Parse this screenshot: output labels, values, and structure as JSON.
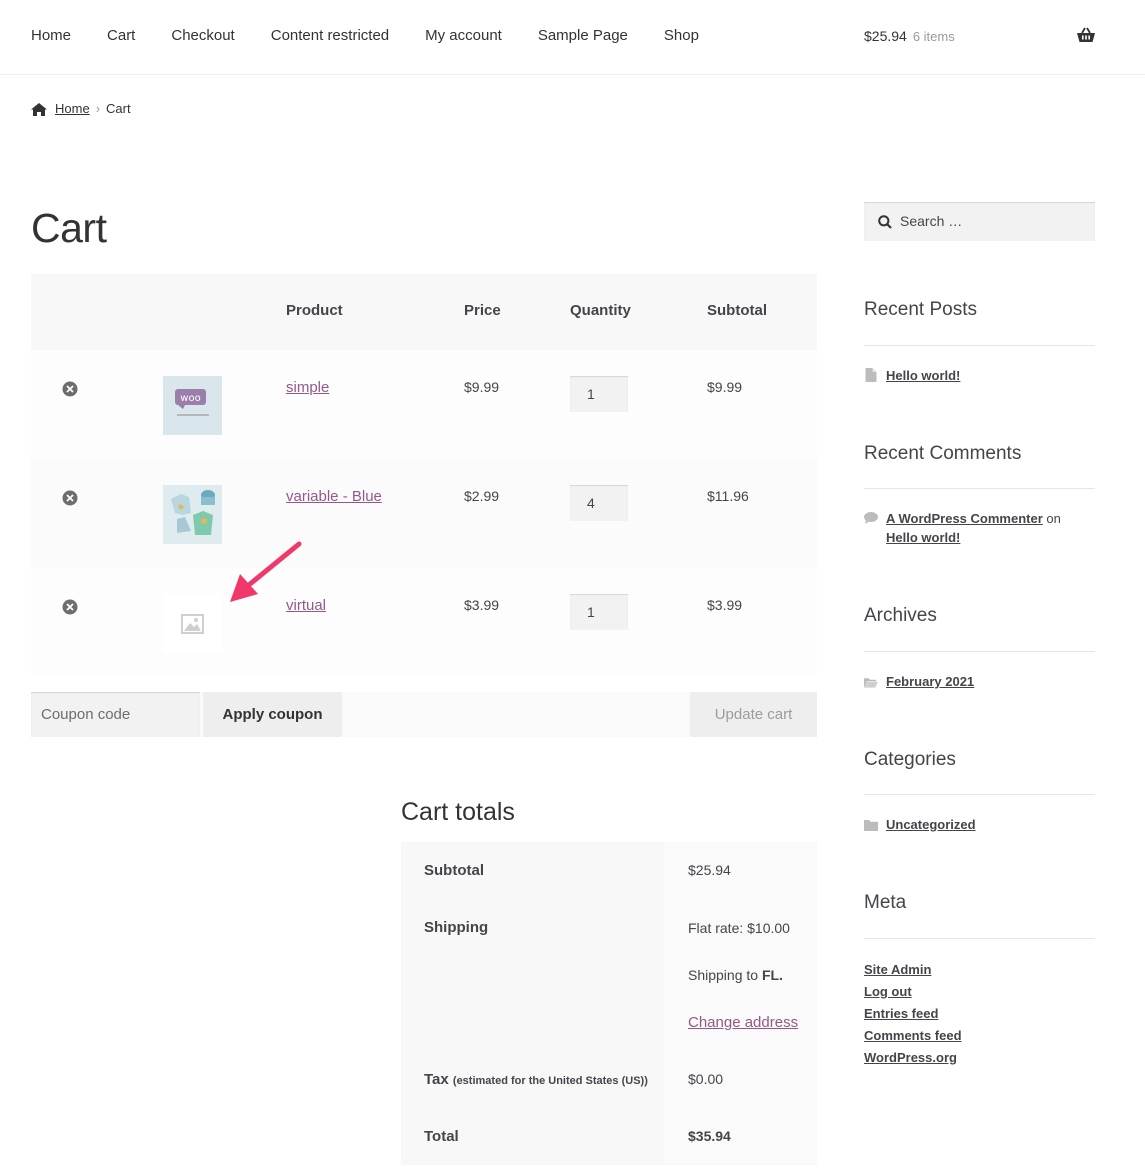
{
  "nav": {
    "items": [
      "Home",
      "Cart",
      "Checkout",
      "Content restricted",
      "My account",
      "Sample Page",
      "Shop"
    ]
  },
  "mini_cart": {
    "amount": "$25.94",
    "count": "6 items"
  },
  "breadcrumb": {
    "home": "Home",
    "current": "Cart"
  },
  "page_title": "Cart",
  "cart_table": {
    "headers": {
      "product": "Product",
      "price": "Price",
      "quantity": "Quantity",
      "subtotal": "Subtotal"
    },
    "rows": [
      {
        "name": "simple",
        "price": "$9.99",
        "qty": "1",
        "subtotal": "$9.99"
      },
      {
        "name": "variable - Blue",
        "price": "$2.99",
        "qty": "4",
        "subtotal": "$11.96"
      },
      {
        "name": "virtual",
        "price": "$3.99",
        "qty": "1",
        "subtotal": "$3.99"
      }
    ]
  },
  "actions": {
    "coupon_placeholder": "Coupon code",
    "apply_label": "Apply coupon",
    "update_label": "Update cart"
  },
  "totals": {
    "title": "Cart totals",
    "subtotal_label": "Subtotal",
    "subtotal_value": "$25.94",
    "shipping_label": "Shipping",
    "shipping_rate": "Flat rate: $10.00",
    "shipping_to": "Shipping to",
    "shipping_state": "FL.",
    "change_address": "Change address",
    "tax_label": "Tax",
    "tax_note": "(estimated for the United States (US))",
    "tax_value": "$0.00",
    "total_label": "Total",
    "total_value": "$35.94"
  },
  "sidebar": {
    "search_placeholder": "Search …",
    "recent_posts_title": "Recent Posts",
    "recent_post": "Hello world!",
    "recent_comments_title": "Recent Comments",
    "comment_author": "A WordPress Commenter",
    "comment_on": "on",
    "comment_post": "Hello world!",
    "archives_title": "Archives",
    "archive": "February 2021",
    "categories_title": "Categories",
    "category": "Uncategorized",
    "meta_title": "Meta",
    "meta_links": [
      "Site Admin",
      "Log out",
      "Entries feed",
      "Comments feed",
      "WordPress.org"
    ]
  },
  "colors": {
    "link": "#96588a",
    "arrow": "#f0386b"
  }
}
